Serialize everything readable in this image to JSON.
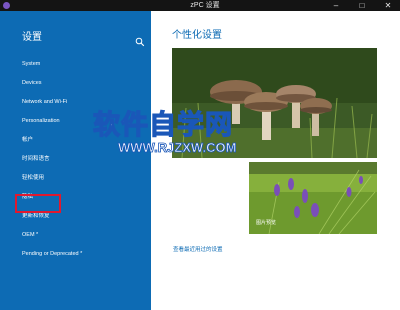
{
  "window": {
    "title": "zPC 设置",
    "minimize_glyph": "–",
    "maximize_glyph": "□",
    "close_glyph": "✕"
  },
  "sidebar": {
    "heading": "设置",
    "items": [
      {
        "label": "System"
      },
      {
        "label": "Devices"
      },
      {
        "label": "Network and Wi-Fi"
      },
      {
        "label": "Personalization"
      },
      {
        "label": "帐户"
      },
      {
        "label": "时间和语言"
      },
      {
        "label": "轻松使用"
      },
      {
        "label": "隐私"
      },
      {
        "label": "更新和恢复"
      },
      {
        "label": "OEM *"
      },
      {
        "label": "Pending or Deprecated *"
      }
    ]
  },
  "main": {
    "heading": "个性化设置",
    "start_caption": "图片预览",
    "more_link": "查看最近用过的设置"
  },
  "watermark": {
    "text": "软件自学网",
    "url": "WWW.RJZXW.COM"
  },
  "colors": {
    "accent": "#0d6bb4",
    "highlight_border": "#e0192f",
    "titlebar": "#141414"
  }
}
